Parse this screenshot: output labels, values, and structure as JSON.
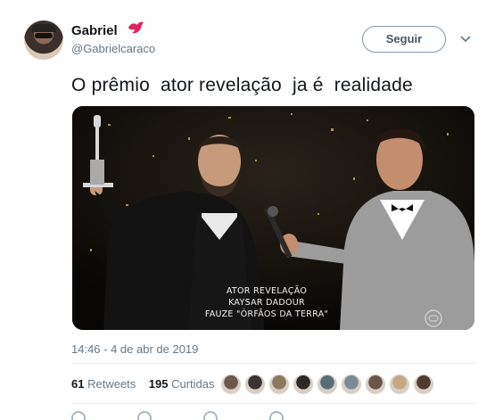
{
  "user": {
    "display_name": "Gabriel",
    "handle": "@Gabrielcaraco",
    "avatar_icon": "avatar-photo",
    "badge_icon": "red-bird-icon"
  },
  "header": {
    "follow_label": "Seguir",
    "menu_icon": "chevron-down-icon"
  },
  "tweet": {
    "text": "O prêmio  ator revelação  ja é  realidade",
    "media": {
      "caption_line1": "ATOR REVELAÇÃO",
      "caption_line2": "KAYSAR DADOUR",
      "caption_line3": "FAUZE \"ÓRFÃOS DA TERRA\"",
      "watermark_icon": "globo-logo-icon"
    },
    "timestamp": "14:46 - 4 de abr de 2019"
  },
  "stats": {
    "retweets_count": "61",
    "retweets_label": "Retweets",
    "likes_count": "195",
    "likes_label": "Curtidas",
    "liker_colors": [
      "#6b5a4a",
      "#3b3330",
      "#8c7a5e",
      "#2d2a28",
      "#5a6e7a",
      "#7a8a96",
      "#6a5648",
      "#c4a882",
      "#4e3a30"
    ]
  },
  "actions": {
    "icons": [
      "reply-icon",
      "retweet-icon",
      "like-icon",
      "message-icon"
    ]
  },
  "colors": {
    "accent_red": "#e0245e",
    "muted_text": "#657786",
    "border": "#e6ecf0"
  }
}
